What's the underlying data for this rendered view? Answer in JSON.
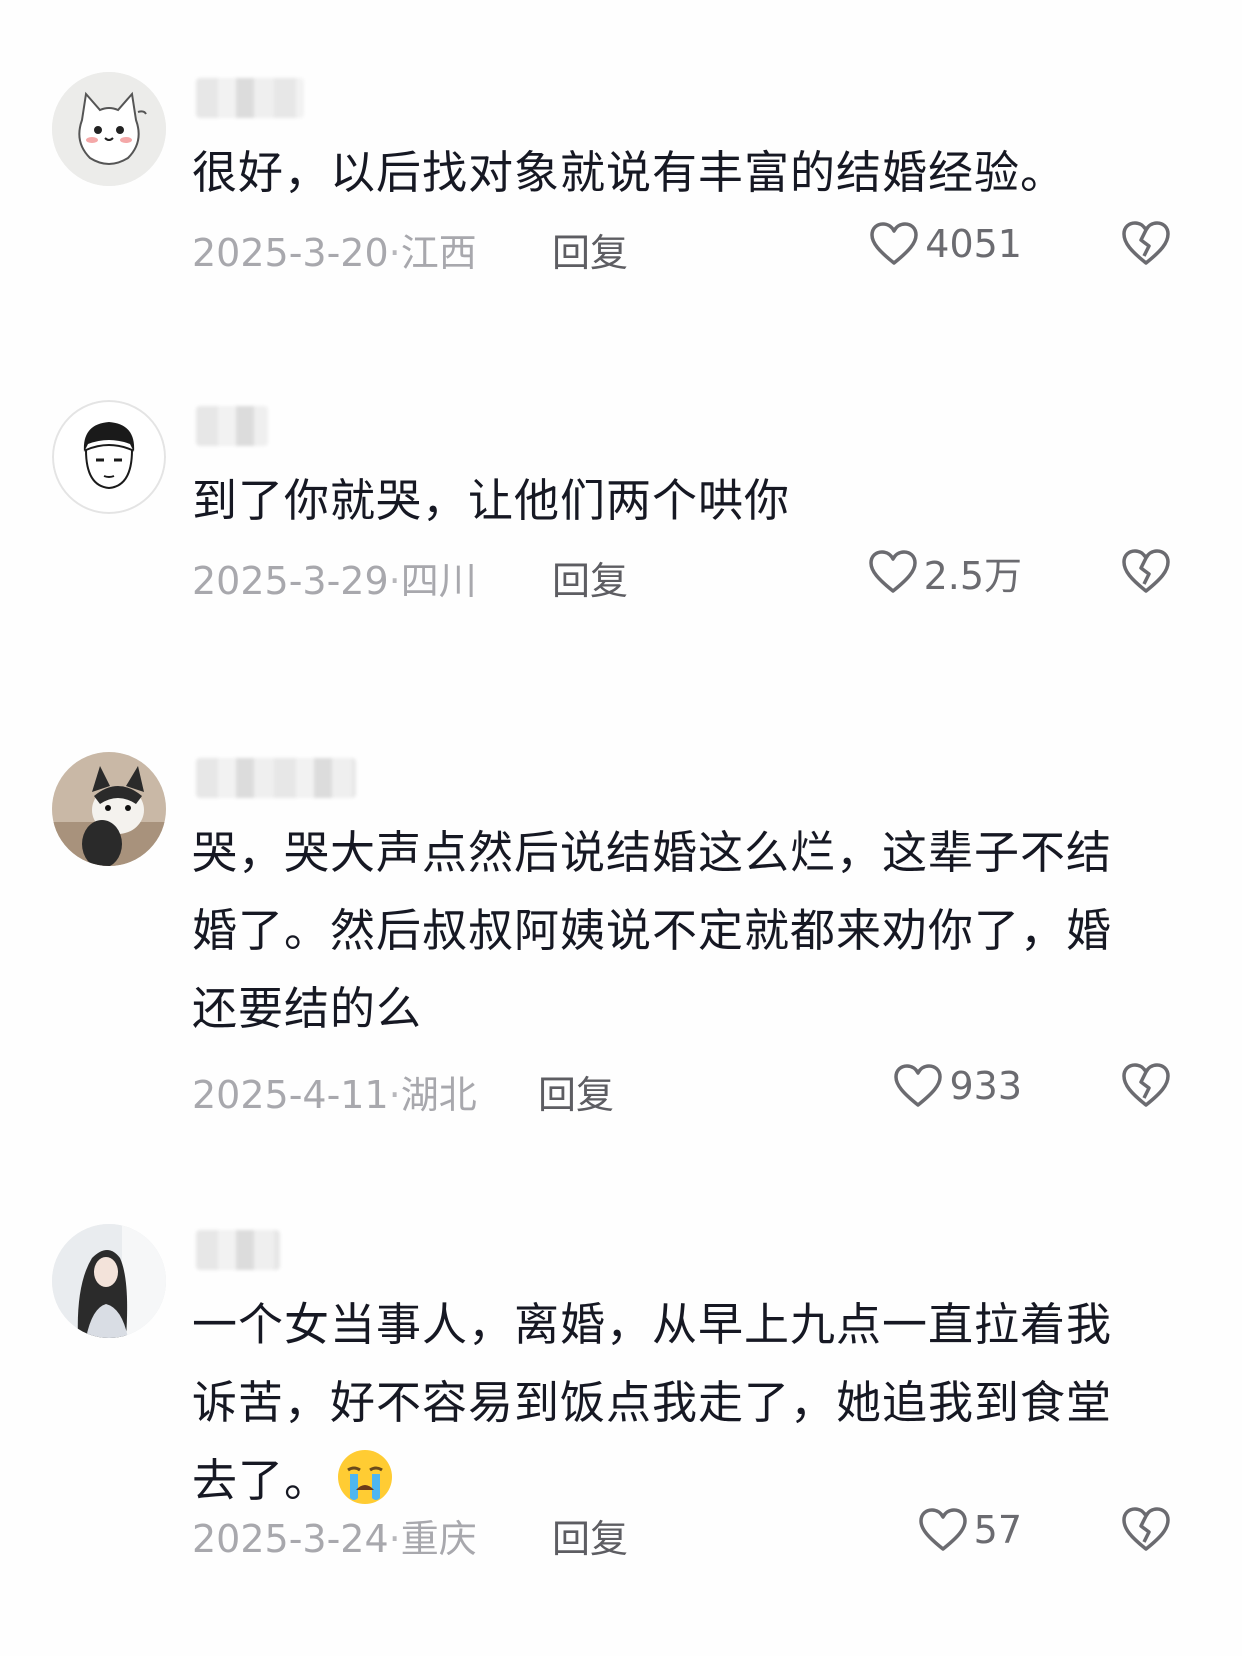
{
  "comments": [
    {
      "avatar": "cartoon-cat-avatar",
      "text": "很好，以后找对象就说有丰富的结婚经验。",
      "date": "2025-3-20",
      "location": "江西",
      "reply_label": "回复",
      "likes": "4051"
    },
    {
      "avatar": "cartoon-boy-avatar",
      "text": "到了你就哭，让他们两个哄你",
      "date": "2025-3-29",
      "location": "四川",
      "reply_label": "回复",
      "likes": "2.5万"
    },
    {
      "avatar": "cat-photo-avatar",
      "text": "哭，哭大声点然后说结婚这么烂，这辈子不结婚了。然后叔叔阿姨说不定就都来劝你了，婚还要结的么",
      "date": "2025-4-11",
      "location": "湖北",
      "reply_label": "回复",
      "likes": "933"
    },
    {
      "avatar": "girl-photo-avatar",
      "text": "一个女当事人，离婚，从早上九点一直拉着我诉苦，好不容易到饭点我走了，她追我到食堂去了。",
      "emoji": "crying-face-emoji",
      "date": "2025-3-24",
      "location": "重庆",
      "reply_label": "回复",
      "likes": "57"
    }
  ],
  "colors": {
    "text": "#161823",
    "meta": "#a8a8ad",
    "reply": "#5d5d62",
    "icon": "#6b6b70"
  }
}
